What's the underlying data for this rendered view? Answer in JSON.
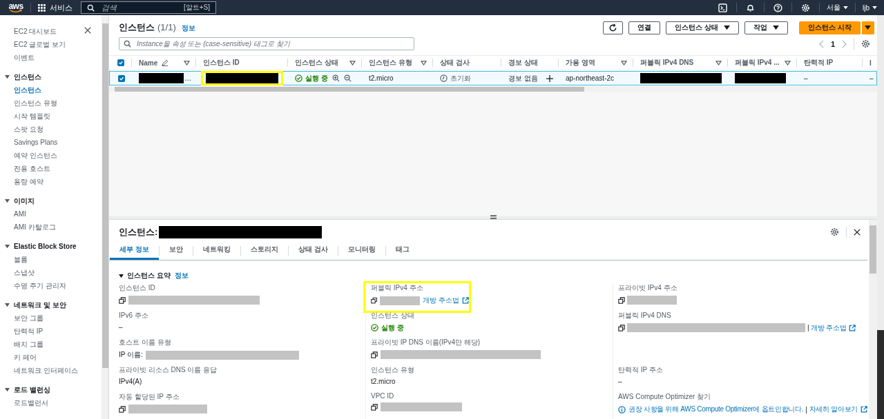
{
  "top_nav": {
    "logo": "aws",
    "services": "서비스",
    "search_placeholder": "검색",
    "search_shortcut": "[알트+S]",
    "region": "서울",
    "user": "ljb"
  },
  "sidebar": {
    "items": [
      {
        "kind": "link",
        "label": "EC2 대시보드",
        "selected": false
      },
      {
        "kind": "link",
        "label": "EC2 글로벌 보기",
        "selected": false
      },
      {
        "kind": "link",
        "label": "이벤트",
        "selected": false
      },
      {
        "kind": "section",
        "label": "인스턴스",
        "expanded": true,
        "children": [
          {
            "label": "인스턴스",
            "selected": true
          },
          {
            "label": "인스턴스 유형",
            "selected": false
          },
          {
            "label": "시작 템플릿",
            "selected": false
          },
          {
            "label": "스팟 요청",
            "selected": false
          },
          {
            "label": "Savings Plans",
            "selected": false
          },
          {
            "label": "예약 인스턴스",
            "selected": false
          },
          {
            "label": "전용 호스트",
            "selected": false
          },
          {
            "label": "용량 예약",
            "selected": false
          }
        ]
      },
      {
        "kind": "section",
        "label": "이미지",
        "expanded": true,
        "children": [
          {
            "label": "AMI",
            "selected": false
          },
          {
            "label": "AMI 카탈로그",
            "selected": false
          }
        ]
      },
      {
        "kind": "section",
        "label": "Elastic Block Store",
        "expanded": true,
        "children": [
          {
            "label": "볼륨",
            "selected": false
          },
          {
            "label": "스냅샷",
            "selected": false
          },
          {
            "label": "수명 주기 관리자",
            "selected": false
          }
        ]
      },
      {
        "kind": "section",
        "label": "네트워크 및 보안",
        "expanded": true,
        "children": [
          {
            "label": "보안 그룹",
            "selected": false
          },
          {
            "label": "탄력적 IP",
            "selected": false
          },
          {
            "label": "배치 그룹",
            "selected": false
          },
          {
            "label": "키 페어",
            "selected": false
          },
          {
            "label": "네트워크 인터페이스",
            "selected": false
          }
        ]
      },
      {
        "kind": "section",
        "label": "로드 밸런싱",
        "expanded": true,
        "children": [
          {
            "label": "로드밸런서",
            "selected": false
          }
        ]
      }
    ]
  },
  "instances": {
    "title": "인스턴스",
    "count": "(1/1)",
    "info": "정보",
    "buttons": [
      {
        "kind": "refresh"
      },
      {
        "kind": "plain",
        "label": "연결"
      },
      {
        "kind": "dropdown",
        "label": "인스턴스 상태"
      },
      {
        "kind": "dropdown",
        "label": "작업"
      },
      {
        "kind": "primary",
        "label": "인스턴스 시작"
      },
      {
        "kind": "primary-caret"
      }
    ],
    "search_placeholder": "Instance을 속성 또는 (case-sensitive) 태그로 찾기",
    "pagination": {
      "page": "1",
      "prev_disabled": true,
      "next_disabled": true
    },
    "table": {
      "select_all_checked": true,
      "columns": [
        {
          "label": "Name",
          "filter": true,
          "editable": true
        },
        {
          "label": "인스턴스 ID"
        },
        {
          "label": "인스턴스 상태",
          "filter": true
        },
        {
          "label": "인스턴스 유형",
          "filter": true
        },
        {
          "label": "상태 검사"
        },
        {
          "label": "경보 상태"
        },
        {
          "label": "가용 영역",
          "filter": true
        },
        {
          "label": "퍼블릭 IPv4 DNS",
          "filter": true
        },
        {
          "label": "퍼블릭 IPv4 ...",
          "filter": true
        },
        {
          "label": "탄력적 IP"
        },
        {
          "label": "I"
        }
      ],
      "rows": [
        {
          "selected": true,
          "checked": true,
          "cells": [
            {
              "kind": "redacted",
              "text": "…"
            },
            {
              "kind": "redacted",
              "highlighted": true
            },
            {
              "kind": "status",
              "text": "실행 중"
            },
            {
              "kind": "text",
              "text": "t2.micro"
            },
            {
              "kind": "check",
              "text": "초기화"
            },
            {
              "kind": "alarm",
              "text": "경보 없음"
            },
            {
              "kind": "text",
              "text": "ap-northeast-2c"
            },
            {
              "kind": "redacted"
            },
            {
              "kind": "redacted"
            },
            {
              "kind": "text",
              "text": "–"
            },
            {
              "kind": "text",
              "text": "–"
            }
          ]
        }
      ]
    }
  },
  "details": {
    "title": "인스턴스:",
    "title_redacted": true,
    "tabs": [
      {
        "label": "세부 정보",
        "selected": true
      },
      {
        "label": "보안",
        "selected": false
      },
      {
        "label": "네트워킹",
        "selected": false
      },
      {
        "label": "스토리지",
        "selected": false
      },
      {
        "label": "상태 검사",
        "selected": false
      },
      {
        "label": "모니터링",
        "selected": false
      },
      {
        "label": "태그",
        "selected": false
      }
    ],
    "section": {
      "title": "인스턴스 요약",
      "expanded": true,
      "info": "정보",
      "rows": [
        [
          {
            "label": "인스턴스 ID",
            "copy": true,
            "redacted": true
          },
          {
            "label": "퍼블릭 IPv4 주소",
            "copy": true,
            "redacted": true,
            "link": "개방 주소법",
            "highlighted": true
          },
          {
            "label": "프라이빗 IPv4 주소",
            "copy": true,
            "redacted": true
          }
        ],
        [
          {
            "label": "IPv6 주소",
            "value": "–"
          },
          {
            "label": "인스턴스 상태",
            "status": "실행 중"
          },
          {
            "label": "퍼블릭 IPv4 DNS",
            "copy": true,
            "redacted": true,
            "separator": "|",
            "link": "개방 주소법"
          }
        ],
        [
          {
            "label": "호스트 이름 유형",
            "prefix": "IP 이름:",
            "redacted": true
          },
          {
            "label": "프라이빗 IP DNS 이름(IPv4만 해당)",
            "copy": true,
            "redacted": true
          }
        ],
        [
          {
            "label": "프라이빗 리소스 DNS 이름 응답",
            "value": "IPv4(A)"
          },
          {
            "label": "인스턴스 유형",
            "value": "t2.micro"
          },
          {
            "label": "탄력적 IP 주소",
            "value": "–"
          }
        ],
        [
          {
            "label": "자동 할당된 IP 주소",
            "copy": true,
            "redacted": true
          },
          {
            "label": "VPC ID",
            "copy": true,
            "redacted": true
          },
          {
            "label": "AWS Compute Optimizer 찾기",
            "notice": "권장 사항을 위해 AWS Compute Optimizer에 옵트인합니다.",
            "separator": "|",
            "link": "자세히 알아보기"
          }
        ]
      ]
    }
  }
}
